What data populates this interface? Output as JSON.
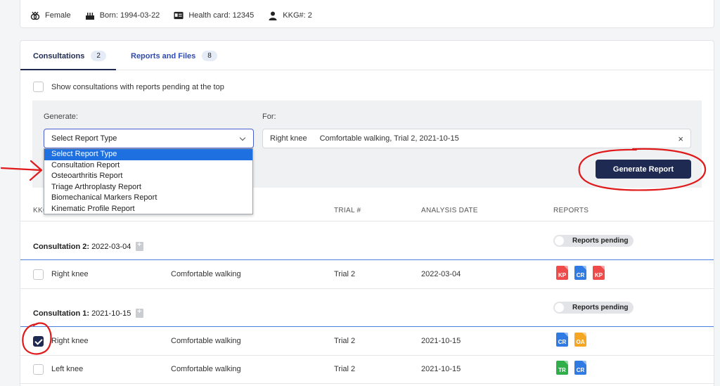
{
  "patient": {
    "gender": "Female",
    "born": "Born: 1994-03-22",
    "health_card": "Health card: 12345",
    "kkg": "KKG#: 2"
  },
  "tabs": [
    {
      "label": "Consultations",
      "count": "2"
    },
    {
      "label": "Reports and Files",
      "count": "8"
    }
  ],
  "pending_toggle_label": "Show consultations with reports pending at the top",
  "generate": {
    "generate_label": "Generate:",
    "for_label": "For:",
    "select_value": "Select Report Type",
    "for_side": "Right knee",
    "for_desc": "Comfortable walking, Trial 2, 2021-10-15",
    "clear": "×",
    "button": "Generate Report"
  },
  "dropdown_options": [
    "Select Report Type",
    "Consultation Report",
    "Osteoarthritis Report",
    "Triage Arthroplasty Report",
    "Biomechanical Markers Report",
    "Kinematic Profile Report"
  ],
  "table": {
    "headers": [
      "KKG",
      "TRIAL #",
      "ANALYSIS DATE",
      "REPORTS"
    ]
  },
  "consultations": [
    {
      "title": "Consultation 2:",
      "date": "2022-03-04",
      "toggle": "Reports pending",
      "rows": [
        {
          "side": "Right knee",
          "activity": "Comfortable walking",
          "trial": "Trial 2",
          "date": "2022-03-04",
          "checked": false,
          "reports": [
            {
              "code": "KP",
              "color": "#ef4b4b"
            },
            {
              "code": "CR",
              "color": "#2f7be3"
            },
            {
              "code": "KP",
              "color": "#ef4b4b"
            }
          ]
        }
      ]
    },
    {
      "title": "Consultation 1:",
      "date": "2021-10-15",
      "toggle": "Reports pending",
      "rows": [
        {
          "side": "Right knee",
          "activity": "Comfortable walking",
          "trial": "Trial 2",
          "date": "2021-10-15",
          "checked": true,
          "reports": [
            {
              "code": "CR",
              "color": "#2f7be3"
            },
            {
              "code": "OA",
              "color": "#f5a623"
            }
          ]
        },
        {
          "side": "Left knee",
          "activity": "Comfortable walking",
          "trial": "Trial 2",
          "date": "2021-10-15",
          "checked": false,
          "reports": [
            {
              "code": "TR",
              "color": "#2fae4a"
            },
            {
              "code": "CR",
              "color": "#2f7be3"
            }
          ]
        }
      ]
    }
  ],
  "colors": {
    "primary": "#1e2a52",
    "annotation": "#e01a1a",
    "selected": "#1e6fe0"
  }
}
